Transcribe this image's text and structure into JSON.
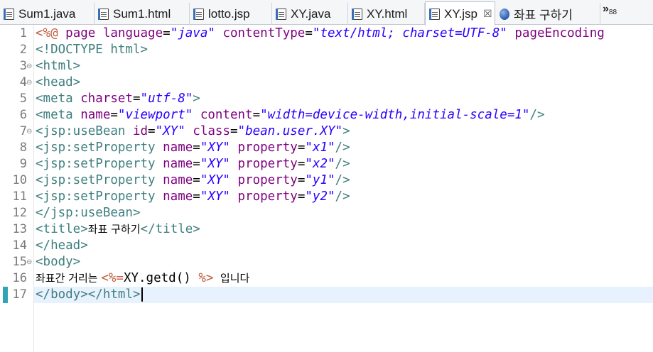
{
  "tabs": [
    {
      "label": "Sum1.java",
      "icon": "java-file-icon"
    },
    {
      "label": "Sum1.html",
      "icon": "html-file-icon"
    },
    {
      "label": "lotto.jsp",
      "icon": "jsp-file-icon"
    },
    {
      "label": "XY.java",
      "icon": "java-file-icon"
    },
    {
      "label": "XY.html",
      "icon": "html-file-icon"
    },
    {
      "label": "XY.jsp",
      "icon": "jsp-file-icon",
      "active": true,
      "close": "☒"
    },
    {
      "label": "좌표 구하기",
      "icon": "web-browser-icon"
    }
  ],
  "overflow": {
    "chevron": "»",
    "count": "88"
  },
  "editor": {
    "line_numbers": [
      "1",
      "2",
      "3",
      "4",
      "5",
      "6",
      "7",
      "8",
      "9",
      "10",
      "11",
      "12",
      "13",
      "14",
      "15",
      "16",
      "17"
    ],
    "lines": [
      [
        {
          "t": "dir",
          "v": "<%@ "
        },
        {
          "t": "attr",
          "v": "page "
        },
        {
          "t": "attr",
          "v": "language"
        },
        {
          "t": "txt",
          "v": "="
        },
        {
          "t": "str",
          "v": "\"java\""
        },
        {
          "t": "txt",
          "v": " "
        },
        {
          "t": "attr",
          "v": "contentType"
        },
        {
          "t": "txt",
          "v": "="
        },
        {
          "t": "str",
          "v": "\"text/html; charset=UTF-8\""
        },
        {
          "t": "txt",
          "v": " "
        },
        {
          "t": "attr",
          "v": "pageEncoding"
        }
      ],
      [
        {
          "t": "tag",
          "v": "<!DOCTYPE html>"
        }
      ],
      [
        {
          "t": "tag",
          "v": "<html>"
        }
      ],
      [
        {
          "t": "tag",
          "v": "<head>"
        }
      ],
      [
        {
          "t": "tag",
          "v": "<meta "
        },
        {
          "t": "attr",
          "v": "charset"
        },
        {
          "t": "txt",
          "v": "="
        },
        {
          "t": "str",
          "v": "\"utf-8\""
        },
        {
          "t": "tag",
          "v": ">"
        }
      ],
      [
        {
          "t": "tag",
          "v": "<meta "
        },
        {
          "t": "attr",
          "v": "name"
        },
        {
          "t": "txt",
          "v": "="
        },
        {
          "t": "str",
          "v": "\"viewport\""
        },
        {
          "t": "txt",
          "v": " "
        },
        {
          "t": "attr",
          "v": "content"
        },
        {
          "t": "txt",
          "v": "="
        },
        {
          "t": "str",
          "v": "\"width=device-width,initial-scale=1\""
        },
        {
          "t": "tag",
          "v": "/>"
        }
      ],
      [
        {
          "t": "tag",
          "v": "<jsp:useBean "
        },
        {
          "t": "attr",
          "v": "id"
        },
        {
          "t": "txt",
          "v": "="
        },
        {
          "t": "str",
          "v": "\"XY\""
        },
        {
          "t": "txt",
          "v": " "
        },
        {
          "t": "attr",
          "v": "class"
        },
        {
          "t": "txt",
          "v": "="
        },
        {
          "t": "str",
          "v": "\"bean.user.XY\""
        },
        {
          "t": "tag",
          "v": ">"
        }
      ],
      [
        {
          "t": "tag",
          "v": "<jsp:setProperty "
        },
        {
          "t": "attr",
          "v": "name"
        },
        {
          "t": "txt",
          "v": "="
        },
        {
          "t": "str",
          "v": "\"XY\""
        },
        {
          "t": "txt",
          "v": " "
        },
        {
          "t": "attr",
          "v": "property"
        },
        {
          "t": "txt",
          "v": "="
        },
        {
          "t": "str",
          "v": "\"x1\""
        },
        {
          "t": "tag",
          "v": "/>"
        }
      ],
      [
        {
          "t": "tag",
          "v": "<jsp:setProperty "
        },
        {
          "t": "attr",
          "v": "name"
        },
        {
          "t": "txt",
          "v": "="
        },
        {
          "t": "str",
          "v": "\"XY\""
        },
        {
          "t": "txt",
          "v": " "
        },
        {
          "t": "attr",
          "v": "property"
        },
        {
          "t": "txt",
          "v": "="
        },
        {
          "t": "str",
          "v": "\"x2\""
        },
        {
          "t": "tag",
          "v": "/>"
        }
      ],
      [
        {
          "t": "tag",
          "v": "<jsp:setProperty "
        },
        {
          "t": "attr",
          "v": "name"
        },
        {
          "t": "txt",
          "v": "="
        },
        {
          "t": "str",
          "v": "\"XY\""
        },
        {
          "t": "txt",
          "v": " "
        },
        {
          "t": "attr",
          "v": "property"
        },
        {
          "t": "txt",
          "v": "="
        },
        {
          "t": "str",
          "v": "\"y1\""
        },
        {
          "t": "tag",
          "v": "/>"
        }
      ],
      [
        {
          "t": "tag",
          "v": "<jsp:setProperty "
        },
        {
          "t": "attr",
          "v": "name"
        },
        {
          "t": "txt",
          "v": "="
        },
        {
          "t": "str",
          "v": "\"XY\""
        },
        {
          "t": "txt",
          "v": " "
        },
        {
          "t": "attr",
          "v": "property"
        },
        {
          "t": "txt",
          "v": "="
        },
        {
          "t": "str",
          "v": "\"y2\""
        },
        {
          "t": "tag",
          "v": "/>"
        }
      ],
      [
        {
          "t": "tag",
          "v": "</jsp:useBean>"
        }
      ],
      [
        {
          "t": "tag",
          "v": "<title>"
        },
        {
          "t": "kor",
          "v": "좌표 구하기"
        },
        {
          "t": "tag",
          "v": "</title>"
        }
      ],
      [
        {
          "t": "tag",
          "v": "</head>"
        }
      ],
      [
        {
          "t": "tag",
          "v": "<body>"
        }
      ],
      [
        {
          "t": "kor",
          "v": "좌표간 거리는 "
        },
        {
          "t": "dir",
          "v": "<%="
        },
        {
          "t": "txt",
          "v": "XY.getd() "
        },
        {
          "t": "dir",
          "v": "%>"
        },
        {
          "t": "kor",
          "v": "  입니다"
        }
      ],
      [
        {
          "t": "tag",
          "v": "</body></html>"
        }
      ]
    ],
    "fold_lines": [
      3,
      4,
      7,
      15
    ],
    "fold_marker": "⊖",
    "current_line": 17
  },
  "colors": {
    "tag": "#3f7f7f",
    "attr": "#7f007f",
    "string": "#2a00ff",
    "directive": "#bf5f3f",
    "current_line_bg": "#e8f2fe"
  }
}
